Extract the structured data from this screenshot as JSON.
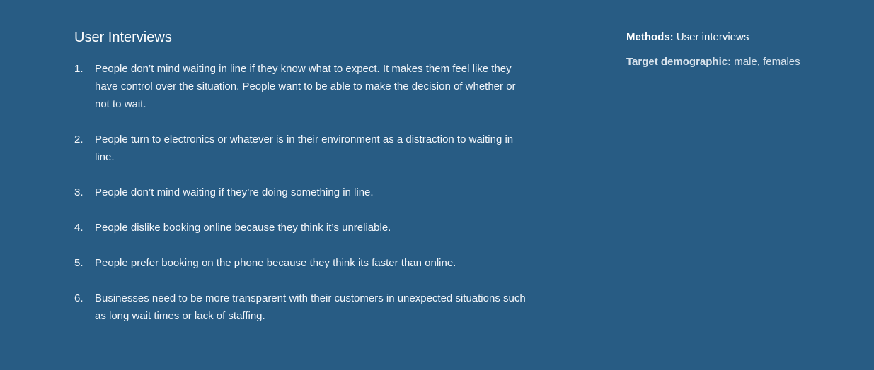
{
  "interviews": {
    "title": "User Interviews",
    "findings": [
      {
        "num": "1.",
        "text": "People don’t mind waiting in line if they know what to expect. It makes them feel like they have control over the situation. People want to be able to make the decision of whether or not to wait."
      },
      {
        "num": "2.",
        "text": "People turn to electronics or whatever is in their environment as a distraction to waiting in line."
      },
      {
        "num": "3.",
        "text": "People don’t mind waiting if they’re doing something in line."
      },
      {
        "num": "4.",
        "text": "People dislike booking online because they think it’s unreliable."
      },
      {
        "num": "5.",
        "text": "People prefer booking on the phone because they think its faster than online."
      },
      {
        "num": "6.",
        "text": "Businesses need to be more transparent with their customers in unexpected situations such as long wait times or lack of staffing."
      }
    ]
  },
  "meta": {
    "methods_label": "Methods:",
    "methods_value": "User interviews",
    "demographic_label": "Target demographic:",
    "demographic_value": "male, females"
  },
  "colors": {
    "background": "#285c84",
    "text": "#ffffff",
    "muted_text": "#d7e2ec"
  }
}
